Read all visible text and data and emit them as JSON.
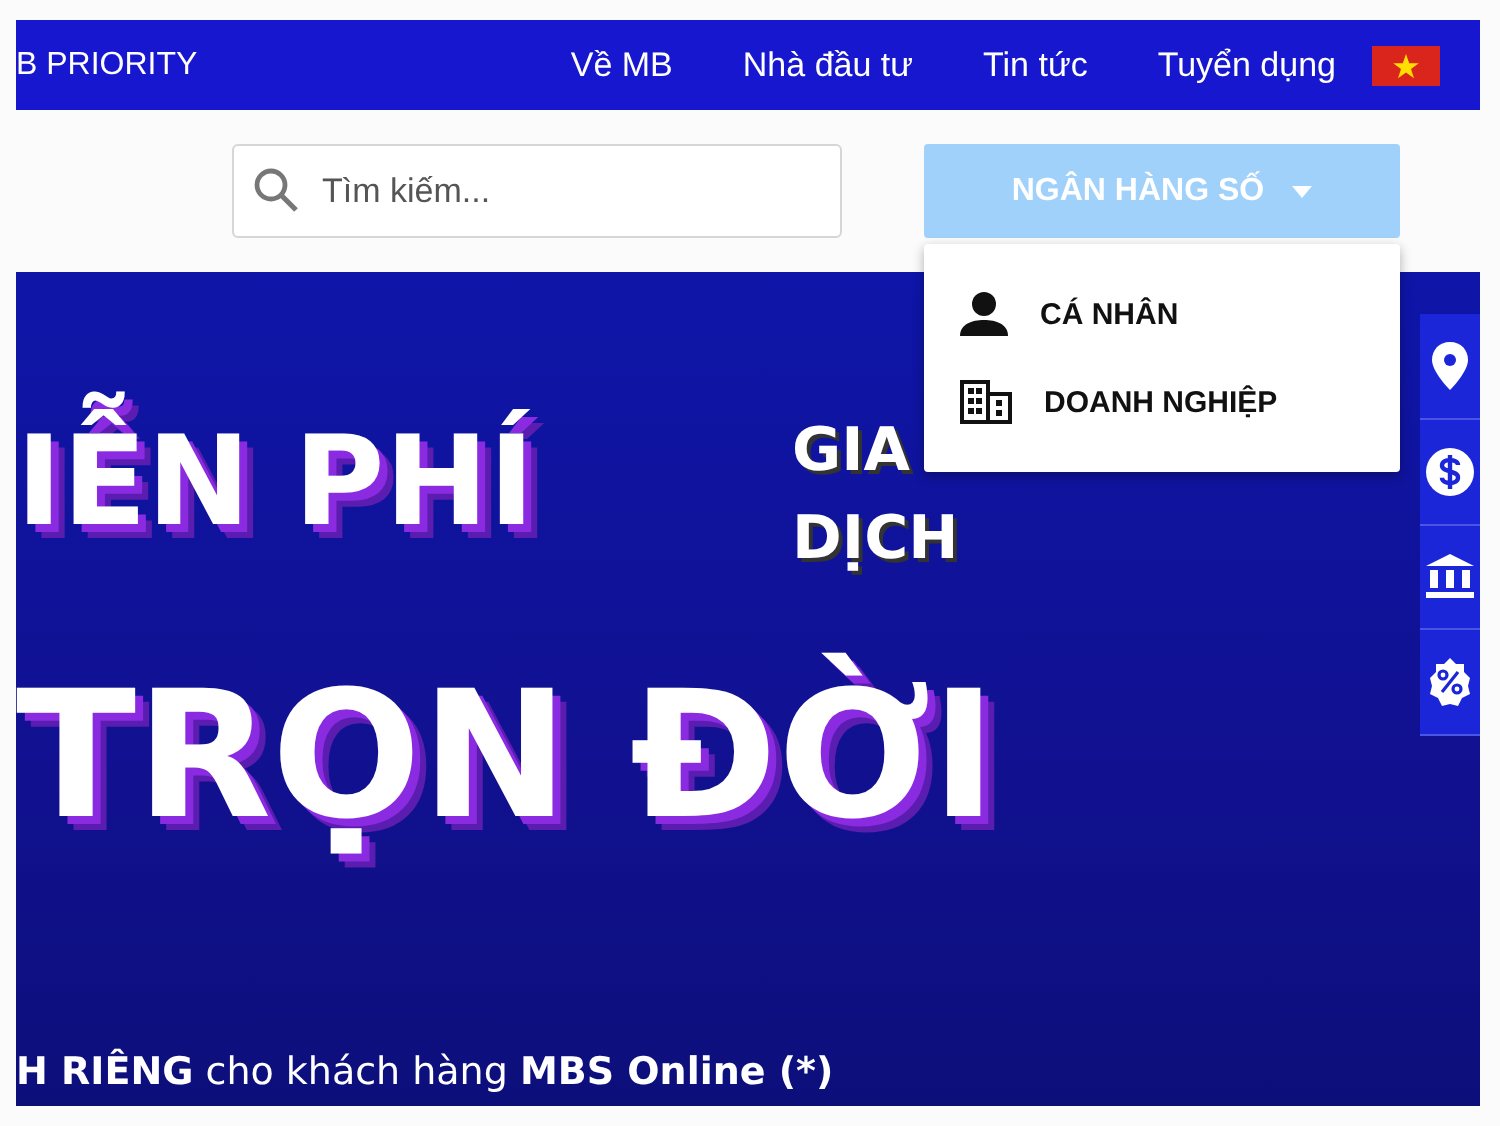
{
  "topbar": {
    "brand": "B PRIORITY",
    "links": [
      "Về MB",
      "Nhà đầu tư",
      "Tin tức",
      "Tuyển dụng"
    ]
  },
  "search": {
    "placeholder": "Tìm kiếm..."
  },
  "digital_banking": {
    "label": "NGÂN HÀNG SỐ",
    "expanded": true,
    "items": [
      {
        "kind": "person",
        "label": "CÁ NHÂN"
      },
      {
        "kind": "business",
        "label": "DOANH NGHIỆP"
      }
    ]
  },
  "banner": {
    "headline_1": "IỄN PHÍ",
    "side_1": "GIA",
    "side_2": "DỊCH",
    "headline_2": "TRỌN ĐỜI",
    "footnote": "**H RIÊNG** cho khách hàng **MBS Online (*)**"
  },
  "quick_links": [
    {
      "kind": "location"
    },
    {
      "kind": "dollar"
    },
    {
      "kind": "bank"
    },
    {
      "kind": "percent"
    }
  ]
}
